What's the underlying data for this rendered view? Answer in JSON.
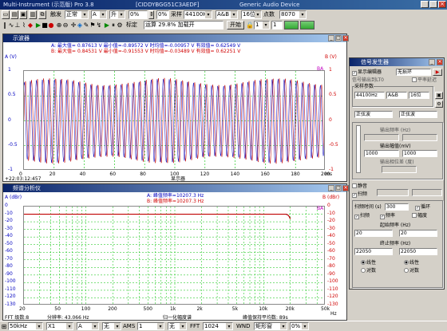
{
  "titlebar": {
    "app": "Multi-Instrument (示范版) Pro 3.8",
    "device": "[CIDDYBGG51C3AEDF]",
    "audio": "Generic Audio Device"
  },
  "toolbar1": {
    "mode": "正常",
    "ch1": "A",
    "trig": "升",
    "zero": "0%",
    "zero_suffix": "%",
    "zero_val": "0%",
    "sample_label": "采样",
    "sample_rate": "44100Hz",
    "channels": "A&B",
    "bits": "16位",
    "points_label": "点数",
    "points": "8070",
    "trig_label": "触发"
  },
  "toolbar2": {
    "zoom_label": "标定",
    "status_text": "运算 29.8% 加载开",
    "start_btn": "开始",
    "val1": "1",
    "val2": "1"
  },
  "oscilloscope": {
    "title": "示波器",
    "stats_a": "A: 最大值= 0.87613 V  最小值=-0.89572 V  时均值=-0.00957 V  有效值= 0.62549 V",
    "stats_b": "B: 最大值= 0.84531 V  最小值=-0.91553 V  时均值=-0.03489 V  有效值= 0.62251 V",
    "y_left_unit": "A (V)",
    "y_right_unit": "B (V)",
    "y_ticks": [
      "1",
      "0.5",
      "0",
      "-0.5",
      "-1"
    ],
    "x_ticks": [
      "0",
      "20",
      "40",
      "60",
      "80",
      "100",
      "120",
      "140",
      "160",
      "180",
      "200"
    ],
    "x_unit": "ms",
    "time_readout": "+22:03:12:457",
    "ba_label": "BA",
    "marker": "显示器"
  },
  "spectrum": {
    "title": "频谱分析仪",
    "y_left_unit": "A (dBr)",
    "y_right_unit": "B (dBr)",
    "y_ticks": [
      "0",
      "-10",
      "-20",
      "-30",
      "-40",
      "-50",
      "-60",
      "-70",
      "-80",
      "-90",
      "-100",
      "-110",
      "-120",
      "-130"
    ],
    "x_ticks": [
      "20",
      "50",
      "100",
      "200",
      "500",
      "1k",
      "2k",
      "5k",
      "10k",
      "20k",
      "50k"
    ],
    "x_unit": "Hz",
    "peak_a": "A: 峰值频率=10207.3 Hz",
    "peak_b": "B: 峰值频率=10207.3 Hz",
    "fft_label": "FFT 级数:8",
    "resolution": "分辨率: 43.066 Hz",
    "normalize": "归一化幅度谱",
    "peak_hold": "峰值保持平均数: 89s",
    "ba_label": "BA"
  },
  "generator": {
    "title": "信号发生器",
    "display_label": "显示编辑器",
    "display_val": "无损环",
    "export_label": "信号输出到LT0",
    "export_chk": "平率延迟",
    "sample_group": "采样参数",
    "rate": "44100Hz",
    "chans": "A&B",
    "bits": "16位",
    "wave_a": "正弦波",
    "wave_b": "正弦波",
    "freq_label": "输出频率 (Hz)",
    "freq_a": "",
    "freq_b": "",
    "amp_label": "输出幅值(mV)",
    "amp_a": "1000",
    "amp_b": "1000",
    "phase_label": "输出相位差 (度)",
    "phase_val": "",
    "mute_label": "静音",
    "output_label": "",
    "sweep_label": "扫频",
    "loop_label": "循环",
    "duration_label": "扫频时间 (s)",
    "duration": "300",
    "step_label": "扫频",
    "mode_a": "频率",
    "mode_b": "幅度",
    "start_freq_label": "起始频率 (Hz)",
    "start_a": "20",
    "start_b": "20",
    "stop_freq_label": "终止频率 (Hz)",
    "stop_a": "22050",
    "stop_b": "22050",
    "lin_label": "线性",
    "log_label": "对数",
    "lin_label_b": "线性",
    "log_label_b": "对数"
  },
  "statusbar": {
    "fft_rate": "50kHz",
    "x_zoom": "X1",
    "ch": "A",
    "none1": "无",
    "ams_label": "AMS",
    "ams": "1",
    "none2": "无",
    "fft_label": "FFT",
    "fft_points": "1024",
    "wnd_label": "WND",
    "window": "矩形窗",
    "overlap": "0%"
  },
  "colors": {
    "trace_a": "#c00000",
    "trace_b": "#0000c0",
    "grid": "#00c000"
  }
}
